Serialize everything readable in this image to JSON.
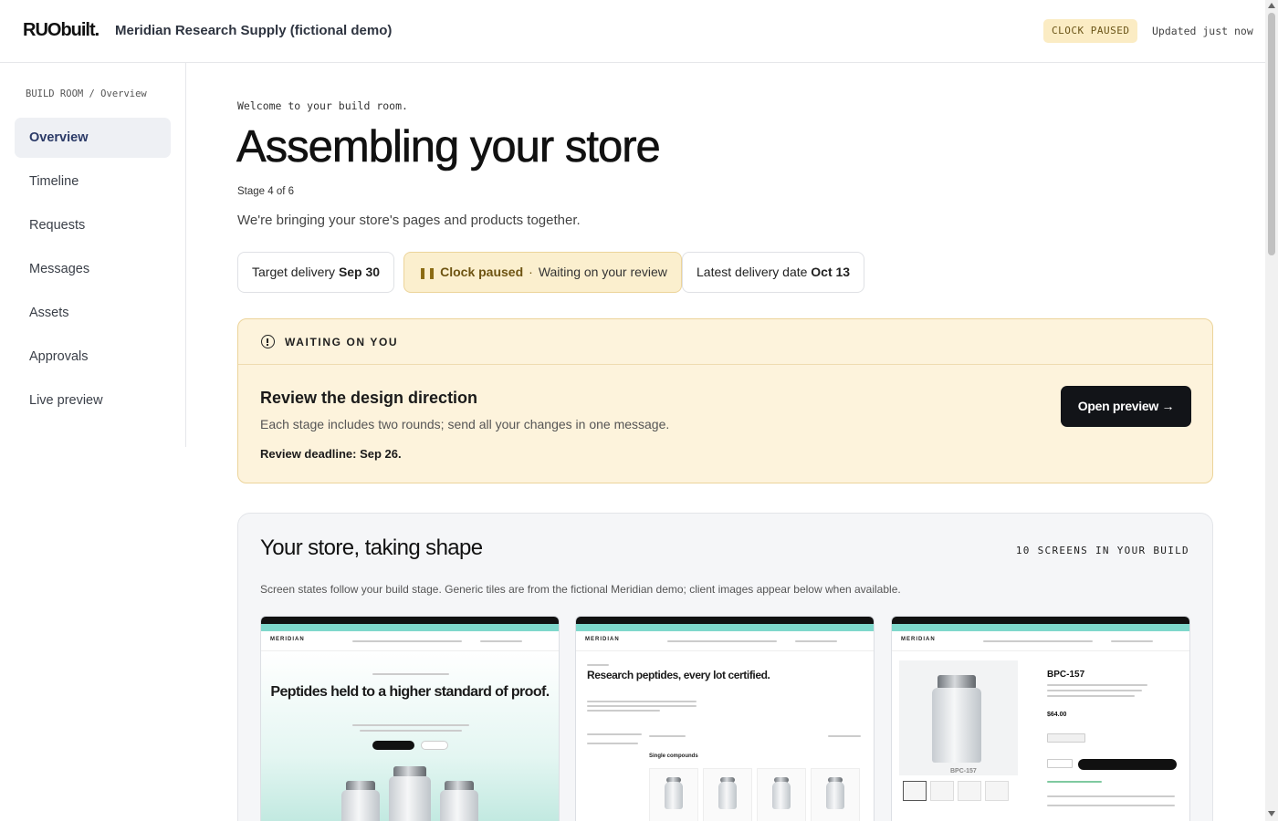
{
  "header": {
    "brand": "RUObuilt.",
    "client_name": "Meridian Research Supply (fictional demo)",
    "clock_badge": "CLOCK PAUSED",
    "updated": "Updated just now"
  },
  "sidebar": {
    "breadcrumb": "BUILD ROOM / Overview",
    "items": [
      {
        "label": "Overview",
        "active": true
      },
      {
        "label": "Timeline"
      },
      {
        "label": "Requests"
      },
      {
        "label": "Messages"
      },
      {
        "label": "Assets"
      },
      {
        "label": "Approvals"
      },
      {
        "label": "Live preview"
      }
    ]
  },
  "main": {
    "welcome": "Welcome to your build room.",
    "title": "Assembling your store",
    "stage": "Stage 4 of 6",
    "subtitle": "We're bringing your store's pages and products together.",
    "pills": {
      "target_label": "Target delivery",
      "target_value": "Sep 30",
      "paused_label": "Clock paused",
      "paused_sep": "·",
      "paused_detail": "Waiting on your review",
      "latest_label": "Latest delivery date",
      "latest_value": "Oct 13"
    },
    "waiting": {
      "label": "WAITING ON YOU",
      "title": "Review the design direction",
      "description": "Each stage includes two rounds; send all your changes in one message.",
      "deadline": "Review deadline: Sep 26.",
      "button": "Open preview →"
    },
    "store_shape": {
      "title": "Your store, taking shape",
      "count": "10 SCREENS IN YOUR BUILD",
      "note": "Screen states follow your build stage. Generic tiles are from the fictional Meridian demo; client images appear below when available.",
      "tiles": [
        {
          "logo": "MERIDIAN",
          "headline": "Peptides held to a higher standard of proof."
        },
        {
          "logo": "MERIDIAN",
          "headline": "Research peptides, every lot certified.",
          "section": "Single compounds"
        },
        {
          "logo": "MERIDIAN",
          "product": "BPC-157",
          "price": "$64.00",
          "vial_label": "BPC-157"
        }
      ]
    }
  },
  "colors": {
    "accent_waiting_bg": "#fdf3dc",
    "accent_mint": "#7fd8cc",
    "active_nav_text": "#2b3a67"
  },
  "icons": {
    "waiting": "info-circle-icon",
    "pause": "pause-icon"
  }
}
